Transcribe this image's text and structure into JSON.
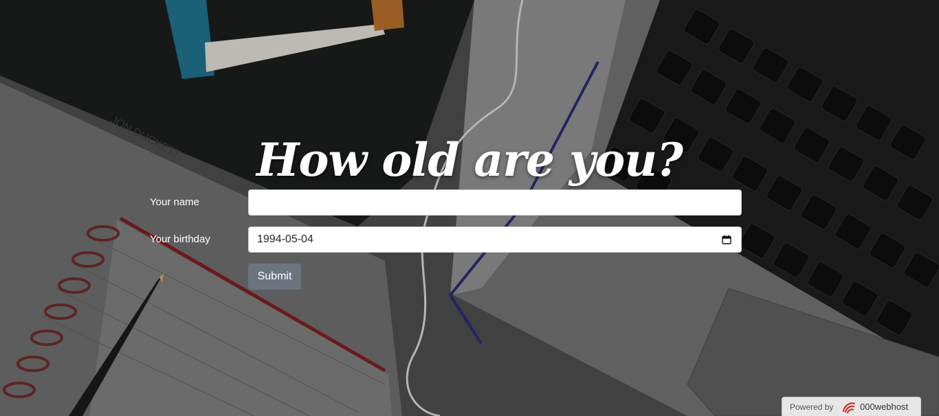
{
  "page": {
    "heading": "How old are you?"
  },
  "form": {
    "name_label": "Your name",
    "name_value": "",
    "birthday_label": "Your birthday",
    "birthday_value": "1994-05-04",
    "submit_label": "Submit"
  },
  "badge": {
    "powered_by": "Powered by",
    "brand": "000webhost"
  },
  "background": {
    "book_author": "JON DUCKETT"
  },
  "icons": {
    "calendar": "calendar-icon",
    "brand_logo": "000webhost-logo-icon"
  },
  "colors": {
    "submit_bg": "#6c757d",
    "heading": "#ffffff",
    "brand_logo": "#d0312d"
  }
}
